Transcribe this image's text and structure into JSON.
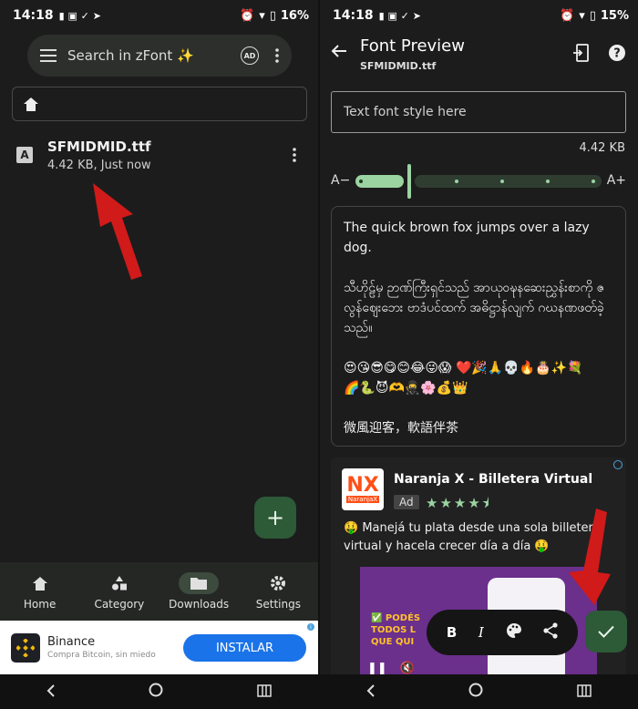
{
  "left": {
    "status": {
      "time": "14:18",
      "battery": "16%"
    },
    "search": {
      "placeholder": "Search in zFont ✨"
    },
    "file": {
      "name": "SFMIDMID.ttf",
      "meta": "4.42 KB, Just now",
      "icon_letter": "A"
    },
    "fab_label": "+",
    "nav": [
      {
        "label": "Home",
        "icon": "home-icon"
      },
      {
        "label": "Category",
        "icon": "category-icon"
      },
      {
        "label": "Downloads",
        "icon": "folder-icon",
        "active": true
      },
      {
        "label": "Settings",
        "icon": "gear-icon"
      }
    ],
    "ad": {
      "title": "Binance",
      "subtitle": "Compra Bitcoin, sin miedo",
      "button": "INSTALAR"
    }
  },
  "right": {
    "status": {
      "time": "14:18",
      "battery": "15%"
    },
    "header": {
      "title": "Font Preview",
      "subtitle": "SFMIDMID.ttf"
    },
    "input": {
      "placeholder": "Text font style here"
    },
    "file_size": "4.42 KB",
    "slider": {
      "min_label": "A−",
      "max_label": "A+",
      "level": 0.17
    },
    "preview": {
      "latin": "The quick brown fox jumps over a lazy dog.",
      "myanmar": "သီဟိုဠ်မှ ဉာဏ်ကြီးရှင်သည် အာယုဝဍ္ဎနဆေးညွှန်းစာကို ဇလွန်ဈေးဘေး ဗာဒံပင်ထက် အဓိဋ္ဌာန်လျက် ဂဃနဏဖတ်ခဲ့သည်။",
      "emoji_line1": "😍😘😎😋😊😂😜😱 ❤️🎉🙏💀🔥🎂✨💐",
      "emoji_line2": "🌈🐍😈🫶🥷🌸💰👑",
      "cjk": "微風迎客，軟語伴茶"
    },
    "ad": {
      "logo": "NX",
      "logo_sub": "NaranjaX",
      "title": "Naranja X - Billetera Virtual",
      "tag": "Ad",
      "rating": 4.5,
      "stars": "★★★★⯨",
      "description": "🤑 Manejá tu plata desde una sola billetera virtual y hacela crecer día a día 🤑",
      "promo": "✅ PODÉS\nTODOS L\nQUE QUI"
    },
    "toolbar": {
      "bold": "B",
      "italic": "I"
    }
  }
}
